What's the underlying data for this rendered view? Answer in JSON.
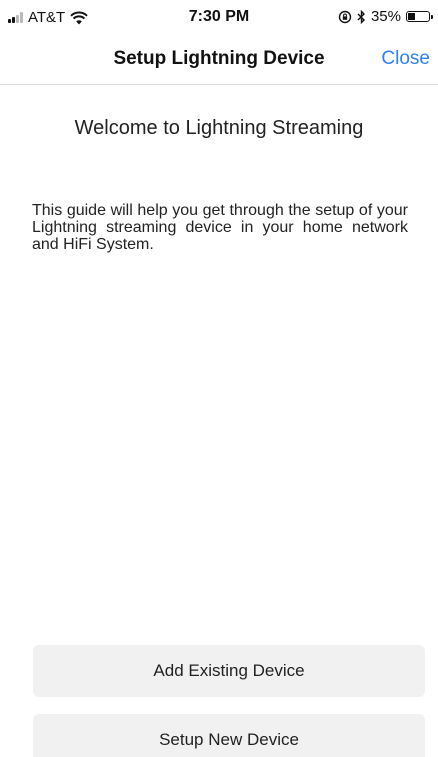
{
  "status_bar": {
    "carrier": "AT&T",
    "time": "7:30 PM",
    "battery_percent": "35%",
    "battery_level": 0.35,
    "icons": [
      "signal-icon",
      "wifi-icon",
      "orientation-lock-icon",
      "bluetooth-icon",
      "battery-icon"
    ]
  },
  "nav": {
    "title": "Setup Lightning Device",
    "close_label": "Close",
    "accent_color": "#2f7ff7"
  },
  "content": {
    "welcome": "Welcome to Lightning Streaming",
    "guide": "This guide will help you get through the setup of your Lightning streaming device in your home network and HiFi System."
  },
  "actions": {
    "add_existing": "Add Existing Device",
    "setup_new": "Setup New Device"
  }
}
